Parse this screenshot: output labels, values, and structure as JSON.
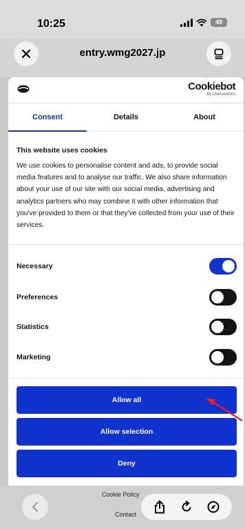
{
  "status_bar": {
    "time": "10:25",
    "battery": "49"
  },
  "browser": {
    "url": "entry.wmg2027.jp"
  },
  "dialog": {
    "brand": {
      "name": "Cookiebot",
      "sub": "by Usercentrics"
    },
    "tabs": [
      {
        "label": "Consent",
        "active": true
      },
      {
        "label": "Details",
        "active": false
      },
      {
        "label": "About",
        "active": false
      }
    ],
    "heading": "This website uses cookies",
    "body": "We use cookies to personalise content and ads, to provide social media features and to analyse our traffic. We also share information about your use of our site with our social media, advertising and analytics partners who may combine it with other information that you've provided to them or that they've collected from your use of their services.",
    "toggles": [
      {
        "label": "Necessary",
        "on": true
      },
      {
        "label": "Preferences",
        "on": false
      },
      {
        "label": "Statistics",
        "on": false
      },
      {
        "label": "Marketing",
        "on": false
      }
    ],
    "buttons": {
      "allow_all": "Allow all",
      "allow_selection": "Allow selection",
      "deny": "Deny"
    }
  },
  "footer": {
    "cookie_policy": "Cookie Policy",
    "contact": "Contact"
  },
  "colors": {
    "accent": "#1032cf",
    "annotation": "#e0202a"
  }
}
